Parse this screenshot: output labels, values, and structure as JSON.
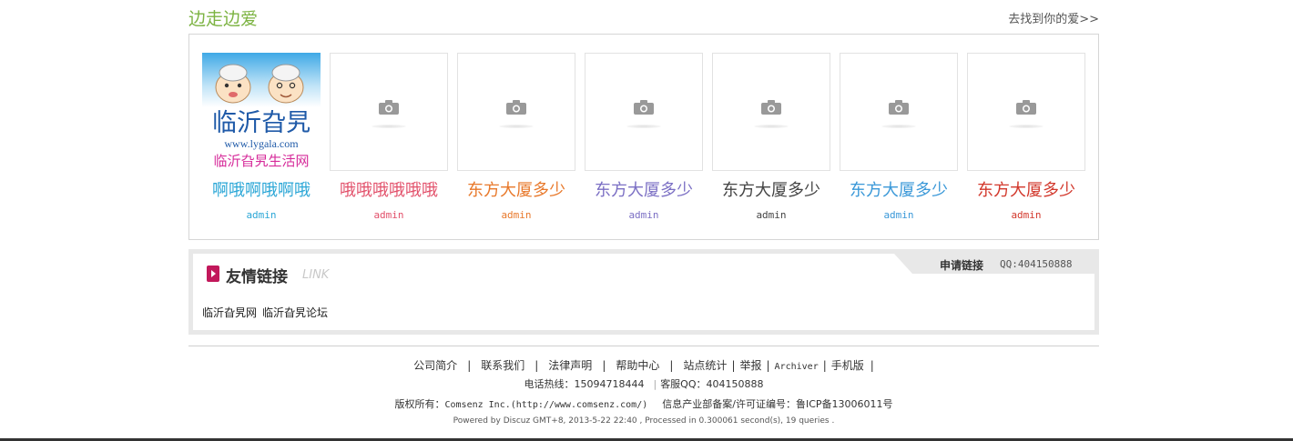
{
  "section": {
    "title": "边走边爱",
    "more_link": "去找到你的爱>>"
  },
  "cards": [
    {
      "title": "啊哦啊哦啊哦",
      "user": "admin",
      "title_color": "#2aa6d6",
      "user_color": "#2aa6d6",
      "image": "logo",
      "logo_text": {
        "main": "临沂旮旯",
        "url": "www.lygala.com",
        "sub": "临沂旮旯生活网"
      }
    },
    {
      "title": "哦哦哦哦哦哦",
      "user": "admin",
      "title_color": "#e2506a",
      "user_color": "#e2506a",
      "image": "camera-placeholder"
    },
    {
      "title": "东方大厦多少",
      "user": "admin",
      "title_color": "#e8782a",
      "user_color": "#e8782a",
      "image": "camera-placeholder"
    },
    {
      "title": "东方大厦多少",
      "user": "admin",
      "title_color": "#7b6fc4",
      "user_color": "#7b6fc4",
      "image": "camera-placeholder"
    },
    {
      "title": "东方大厦多少",
      "user": "admin",
      "title_color": "#444444",
      "user_color": "#444444",
      "image": "camera-placeholder"
    },
    {
      "title": "东方大厦多少",
      "user": "admin",
      "title_color": "#3a98d8",
      "user_color": "#3a98d8",
      "image": "camera-placeholder"
    },
    {
      "title": "东方大厦多少",
      "user": "admin",
      "title_color": "#d2372b",
      "user_color": "#d2372b",
      "image": "camera-placeholder"
    }
  ],
  "friend_links": {
    "title": "友情链接",
    "title_en": "LINK",
    "apply_label": "申请链接",
    "apply_qq": "QQ:404150888",
    "links": [
      "临沂旮旯网",
      "临沂旮旯论坛"
    ]
  },
  "footer": {
    "nav": [
      "公司简介",
      "联系我们",
      "法律声明",
      "帮助中心",
      "站点统计",
      "举报",
      "Archiver",
      "手机版"
    ],
    "tel_label": "电话热线：",
    "tel_value": "15094718444",
    "service_label": "客服QQ：",
    "service_value": "404150888",
    "copyright_label": "版权所有：",
    "copyright_value": "Comsenz Inc.(http://www.comsenz.com/)",
    "icp": "信息产业部备案/许可证编号：鲁ICP备13006011号",
    "powered": "Powered by Discuz  GMT+8, 2013-5-22 22:40 , Processed in 0.300061 second(s), 19 queries ."
  },
  "colors": {
    "section_title": "#7cb342",
    "links_icon": "#c2185b"
  }
}
